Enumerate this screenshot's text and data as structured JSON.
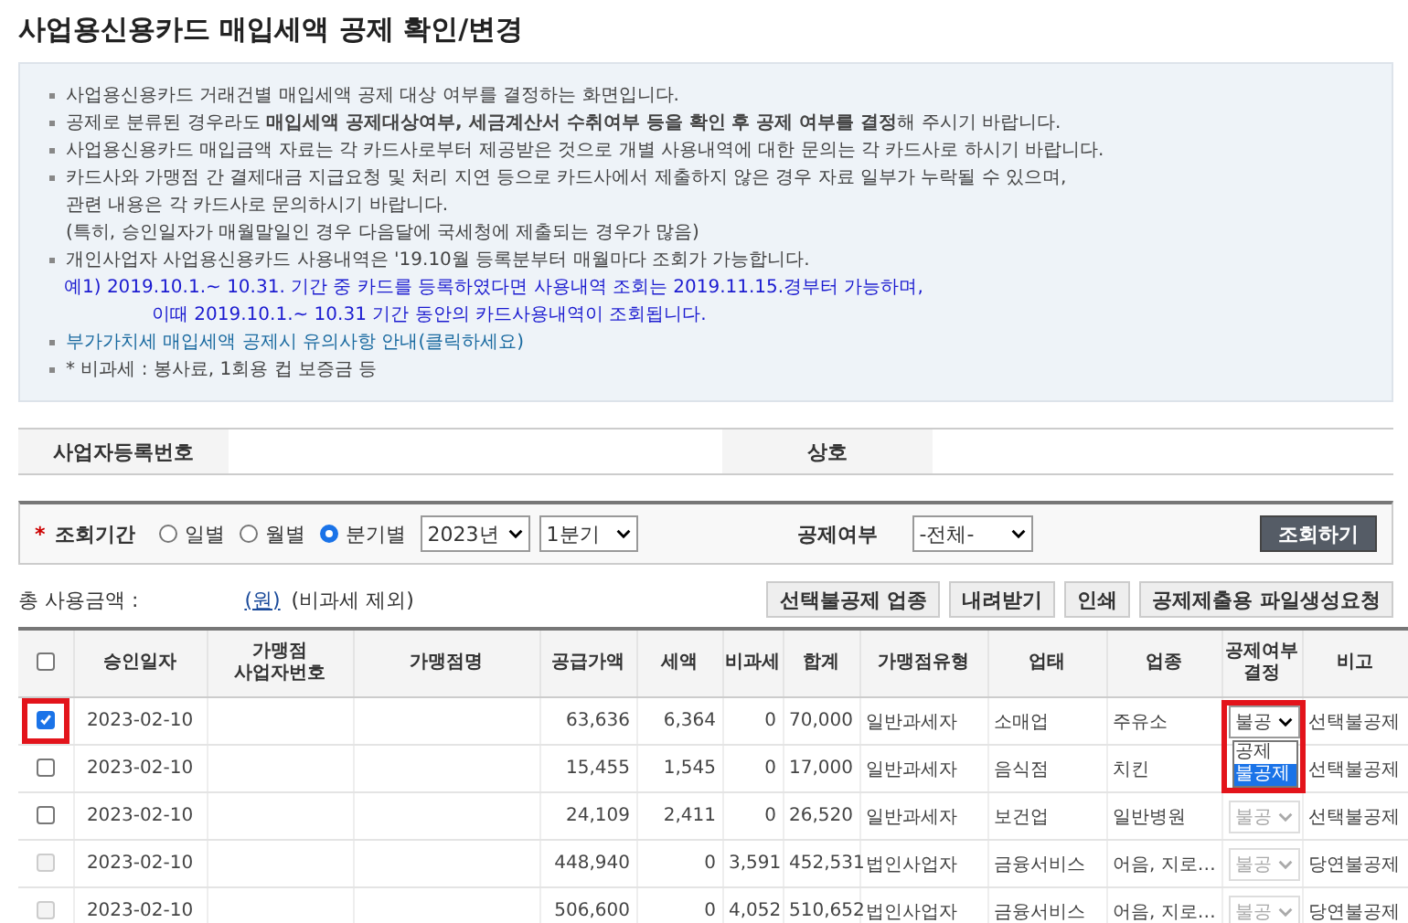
{
  "title": "사업용신용카드 매입세액 공제 확인/변경",
  "notices": [
    {
      "text": "사업용신용카드 거래건별 매입세액 공제 대상 여부를 결정하는 화면입니다.",
      "kind": "bullet"
    },
    {
      "text": "공제로 분류된 경우라도 **매입세액 공제대상여부, 세금계산서 수취여부 등을 확인 후 공제 여부를 결정**해 주시기 바랍니다.",
      "kind": "bullet"
    },
    {
      "text": "사업용신용카드 매입금액 자료는 각 카드사로부터 제공받은 것으로 개별 사용내역에 대한 문의는 각 카드사로 하시기 바랍니다.",
      "kind": "bullet"
    },
    {
      "text": "카드사와 가맹점 간 결제대금 지급요청 및 처리 지연 등으로 카드사에서 제출하지 않은 경우 자료 일부가 누락될 수 있으며,",
      "kind": "bullet"
    },
    {
      "text": "관련 내용은 각 카드사로 문의하시기 바랍니다.",
      "kind": "cont"
    },
    {
      "text": "(특히, 승인일자가 매월말일인 경우 다음달에 국세청에 제출되는 경우가 많음)",
      "kind": "cont"
    },
    {
      "text": "개인사업자 사업용신용카드 사용내역은 '19.10월 등록분부터 매월마다 조회가 가능합니다.",
      "kind": "bullet"
    },
    {
      "text": "예1) 2019.10.1.~ 10.31. 기간 중 카드를 등록하였다면 사용내역 조회는 2019.11.15.경부터 가능하며,",
      "kind": "example"
    },
    {
      "text": "이때 2019.10.1.~ 10.31 기간 동안의 카드사용내역이 조회됩니다.",
      "kind": "example2"
    },
    {
      "text": "부가가치세 매입세액 공제시 유의사항 안내(클릭하세요)",
      "kind": "link"
    },
    {
      "text": "* 비과세 : 봉사료, 1회용 컵 보증금 등",
      "kind": "bullet"
    }
  ],
  "info": {
    "labels": [
      "사업자등록번호",
      "상호"
    ]
  },
  "search": {
    "required_mark": "*",
    "label": "조회기간",
    "periods": [
      {
        "label": "일별",
        "selected": false
      },
      {
        "label": "월별",
        "selected": false
      },
      {
        "label": "분기별",
        "selected": true
      }
    ],
    "year": "2023년",
    "quarter": "1분기",
    "deduct_label": "공제여부",
    "deduct_value": "-전체-",
    "button": "조회하기"
  },
  "summary": {
    "label": "총 사용금액 :",
    "unit": "(원)",
    "note": "(비과세 제외)"
  },
  "actions": [
    "선택불공제 업종",
    "내려받기",
    "인쇄",
    "공제제출용 파일생성요청"
  ],
  "table": {
    "all_checked": false,
    "columns": [
      "승인일자",
      "가맹점\n사업자번호",
      "가맹점명",
      "공급가액",
      "세액",
      "비과세",
      "합계",
      "가맹점유형",
      "업태",
      "업종",
      "공제여부\n결정",
      "비고"
    ],
    "rows": [
      {
        "checked": true,
        "disabled": false,
        "highlighted": true,
        "date": "2023-02-10",
        "supply": "63,636",
        "tax": "6,364",
        "nontax": "0",
        "total": "70,000",
        "type": "일반과세자",
        "biz": "소매업",
        "item": "주유소",
        "decision": "불공",
        "decision_disabled": false,
        "note": "선택불공제",
        "dropdown": [
          {
            "label": "공제",
            "selected": false
          },
          {
            "label": "불공제",
            "selected": true
          }
        ]
      },
      {
        "checked": false,
        "disabled": false,
        "date": "2023-02-10",
        "supply": "15,455",
        "tax": "1,545",
        "nontax": "0",
        "total": "17,000",
        "type": "일반과세자",
        "biz": "음식점",
        "item": "치킨",
        "note": "선택불공제"
      },
      {
        "checked": false,
        "disabled": false,
        "date": "2023-02-10",
        "supply": "24,109",
        "tax": "2,411",
        "nontax": "0",
        "total": "26,520",
        "type": "일반과세자",
        "biz": "보건업",
        "item": "일반병원",
        "decision": "불공",
        "decision_disabled": true,
        "note": "선택불공제"
      },
      {
        "checked": false,
        "disabled": true,
        "date": "2023-02-10",
        "supply": "448,940",
        "tax": "0",
        "nontax": "3,591",
        "total": "452,531",
        "type": "법인사업자",
        "biz": "금융서비스",
        "item": "어음, 지로…",
        "decision": "불공",
        "decision_disabled": true,
        "note": "당연불공제"
      },
      {
        "checked": false,
        "disabled": true,
        "date": "2023-02-10",
        "supply": "506,600",
        "tax": "0",
        "nontax": "4,052",
        "total": "510,652",
        "type": "법인사업자",
        "biz": "금융서비스",
        "item": "어음, 지로…",
        "decision": "불공",
        "decision_disabled": true,
        "note": "당연불공제"
      }
    ]
  }
}
